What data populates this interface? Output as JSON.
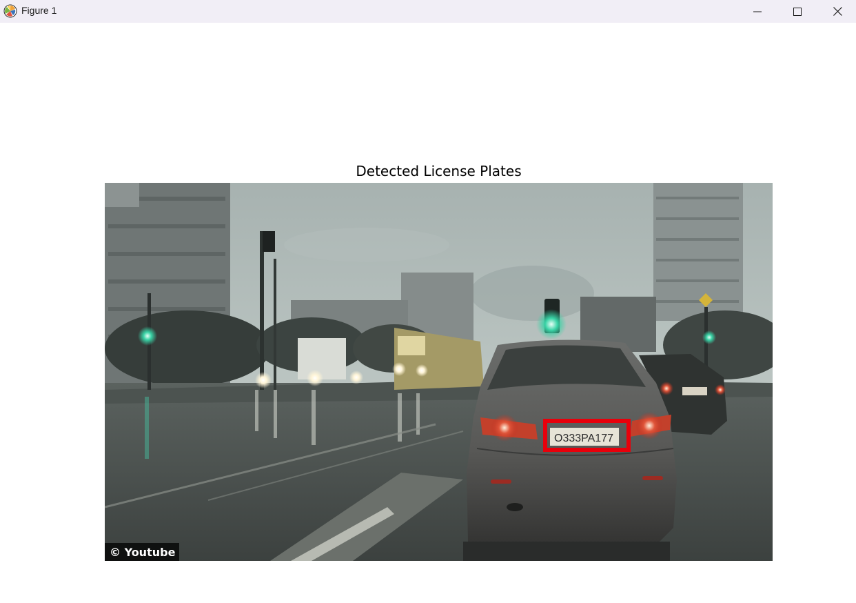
{
  "window": {
    "title": "Figure 1",
    "controls": [
      "minimize-icon",
      "maximize-icon",
      "close-icon"
    ]
  },
  "figure": {
    "title": "Detected License Plates",
    "image": {
      "watermark": "© Youtube",
      "plate_text": "O333PA177",
      "detection_box_color": "#e8000b"
    }
  }
}
